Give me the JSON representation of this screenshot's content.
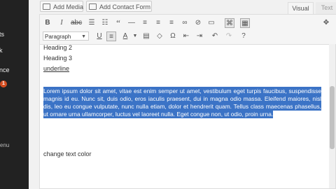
{
  "sidebar": {
    "items": [
      "ts",
      "k",
      "nce"
    ],
    "badge": "1",
    "small_item": "enu"
  },
  "media_buttons": {
    "add_media": "Add Media",
    "add_contact_form": "Add Contact Form"
  },
  "tabs": {
    "visual": "Visual",
    "text": "Text"
  },
  "toolbar": {
    "format_select": "Paragraph"
  },
  "content": {
    "heading2": "Heading 2",
    "heading3": "Heading 3",
    "underline": "underline",
    "paragraph": "Lorem ipsum dolor sit amet, vitae est enim semper ut amet, vestibulum eget turpis faucibus, suspendisse magnis id eu. Nunc sit, duis odio, eros iaculis praesent, dui in magna odio massa. Eleifend maiores, nisl dis, leo eu congue vulputate, nunc nulla etiam, dolor et hendrerit quam. Tellus class maecenas phasellus, ut ornare urna ullamcorper, luctus vel laoreet nulla. Eget congue non, ut odio, proin urna.",
    "change_text": "change text color"
  },
  "colors": {
    "selection": "#3b73c6",
    "sidebar": "#222222"
  }
}
